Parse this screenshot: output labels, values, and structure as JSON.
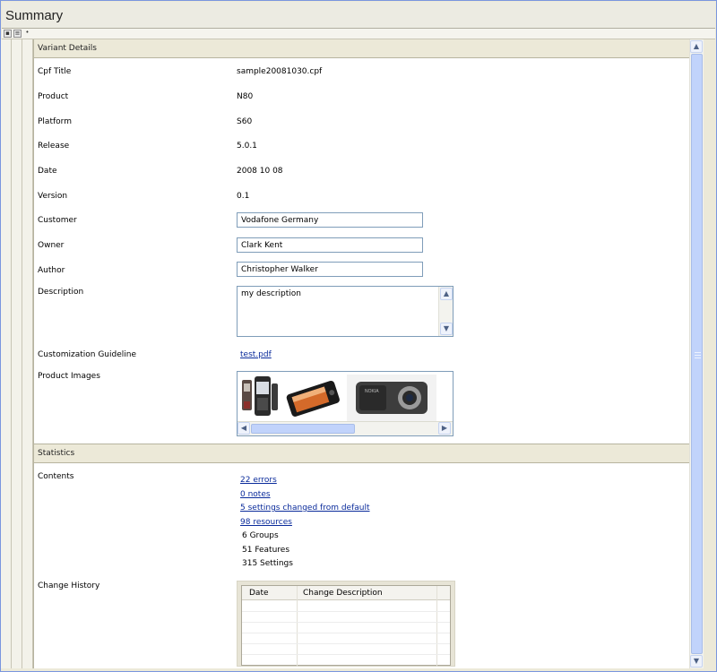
{
  "window": {
    "title": "Summary"
  },
  "toolbar": {
    "collapse_label": "▪",
    "menu_label": "≡",
    "pin_label": "•"
  },
  "variant_details": {
    "title": "Variant Details",
    "cpf_title_label": "Cpf Title",
    "cpf_title_value": "sample20081030.cpf",
    "product_label": "Product",
    "product_value": "N80",
    "platform_label": "Platform",
    "platform_value": "S60",
    "release_label": "Release",
    "release_value": "5.0.1",
    "date_label": "Date",
    "date_value": "2008 10 08",
    "version_label": "Version",
    "version_value": "0.1",
    "customer_label": "Customer",
    "customer_value": "Vodafone Germany",
    "owner_label": "Owner",
    "owner_value": "Clark Kent",
    "author_label": "Author",
    "author_value": "Christopher Walker",
    "description_label": "Description",
    "description_value": "my description",
    "guideline_label": "Customization Guideline",
    "guideline_link": "test.pdf",
    "images_label": "Product Images",
    "image_icons": [
      "phone-image-1",
      "phone-image-2",
      "phone-image-3"
    ]
  },
  "statistics": {
    "title": "Statistics",
    "contents_label": "Contents",
    "errors_link": "22 errors",
    "notes_link": "0 notes",
    "changed_link": "5 settings changed from default",
    "resources_link": "98 resources",
    "groups_text": "6 Groups",
    "features_text": "51 Features",
    "settings_text": "315 Settings",
    "history_label": "Change History",
    "history_columns": [
      "Date",
      "Change Description"
    ]
  },
  "colors": {
    "accent": "#7f9db9",
    "link": "#0a2b9b",
    "section_bg": "#ece9d8",
    "scroll_thumb": "#c1d3fb"
  }
}
